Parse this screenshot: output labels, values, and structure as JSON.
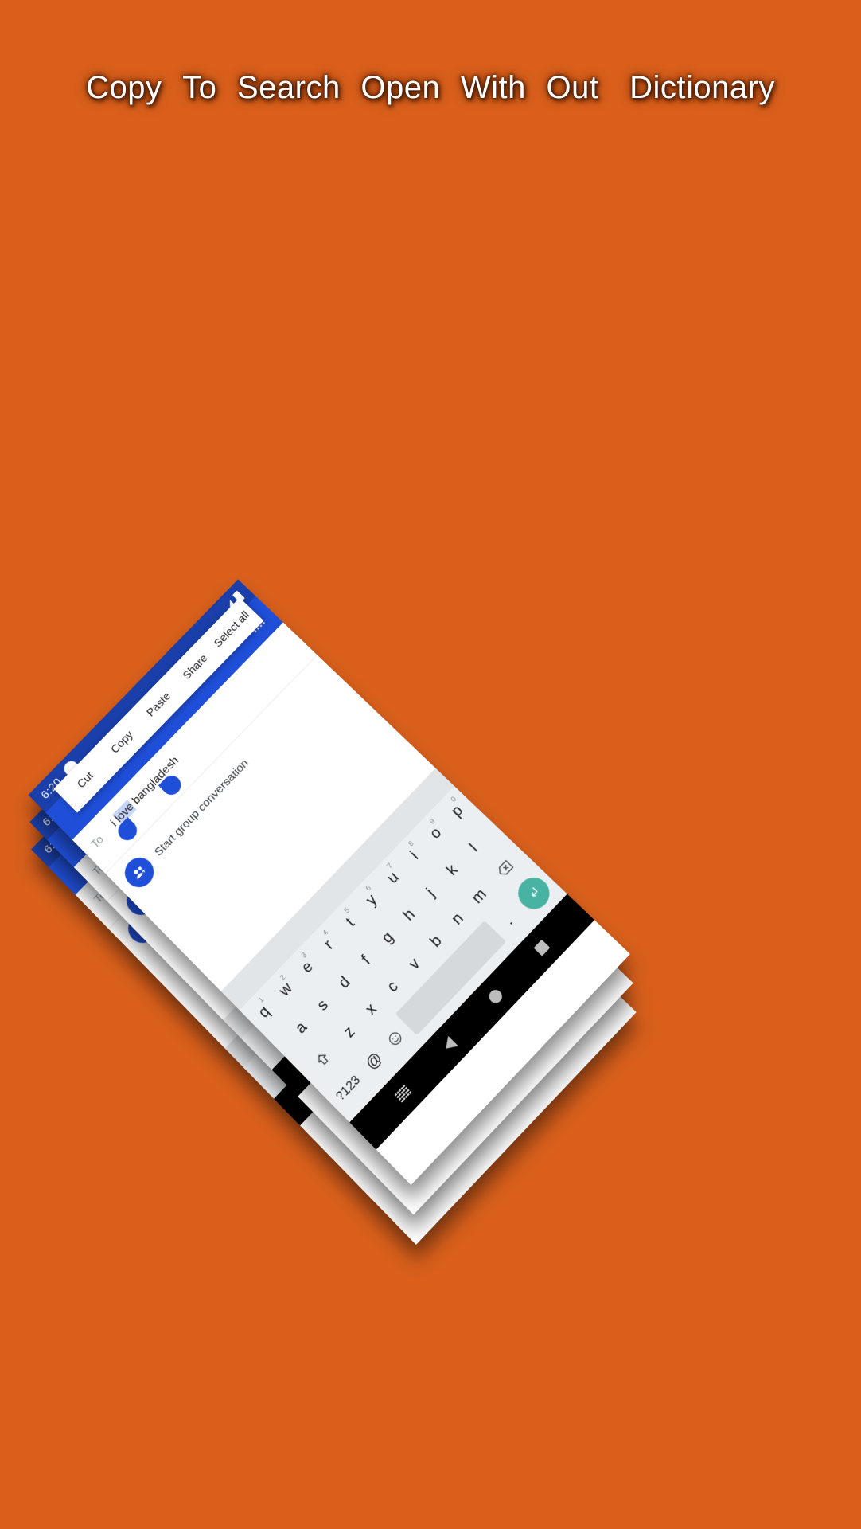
{
  "background_color": "#d95f1b",
  "header": {
    "words": [
      "Copy",
      "To",
      "Search",
      "Open",
      "With",
      "Out",
      "Dictionary"
    ],
    "text_color": "#ffffff",
    "shadow_color": "#3c1604"
  },
  "phone": {
    "status_bar": {
      "time": "6:20",
      "background_color": "#1a3faa",
      "icons": [
        "wifi-signal-icon",
        "battery-icon"
      ]
    },
    "app_bar": {
      "background_color": "#1f4fd8",
      "overflow_icon": "apps-grid-icon"
    },
    "context_menu": {
      "items": [
        "Cut",
        "Copy",
        "Paste",
        "Share",
        "Select all"
      ]
    },
    "compose": {
      "to_label": "To",
      "to_value": "i love bangladesh",
      "selected_fragment": "love",
      "group_label": "Start group conversation",
      "group_icon": "add-group-icon",
      "accent_color": "#1f4fd8",
      "selection_color": "#c6d4f7"
    },
    "keyboard": {
      "background_color": "#eceff1",
      "rows": [
        [
          {
            "label": "q",
            "num": "1"
          },
          {
            "label": "w",
            "num": "2"
          },
          {
            "label": "e",
            "num": "3"
          },
          {
            "label": "r",
            "num": "4"
          },
          {
            "label": "t",
            "num": "5"
          },
          {
            "label": "y",
            "num": "6"
          },
          {
            "label": "u",
            "num": "7"
          },
          {
            "label": "i",
            "num": "8"
          },
          {
            "label": "o",
            "num": "9"
          },
          {
            "label": "p",
            "num": "0"
          }
        ],
        [
          {
            "label": "a",
            "num": ""
          },
          {
            "label": "s",
            "num": ""
          },
          {
            "label": "d",
            "num": ""
          },
          {
            "label": "f",
            "num": ""
          },
          {
            "label": "g",
            "num": ""
          },
          {
            "label": "h",
            "num": ""
          },
          {
            "label": "j",
            "num": ""
          },
          {
            "label": "k",
            "num": ""
          },
          {
            "label": "l",
            "num": ""
          }
        ],
        [
          {
            "label": "shift-icon",
            "num": ""
          },
          {
            "label": "z",
            "num": ""
          },
          {
            "label": "x",
            "num": ""
          },
          {
            "label": "c",
            "num": ""
          },
          {
            "label": "v",
            "num": ""
          },
          {
            "label": "b",
            "num": ""
          },
          {
            "label": "n",
            "num": ""
          },
          {
            "label": "m",
            "num": ""
          },
          {
            "label": "backspace-icon",
            "num": ""
          }
        ]
      ],
      "bottom_row": {
        "symbols_key": "?123",
        "at_key": "@",
        "emoji_key": "emoji-icon",
        "space_key": "",
        "period_key": ".",
        "enter_key": "enter-icon",
        "enter_color": "#49b3a3"
      }
    },
    "nav_bar": {
      "background_color": "#000000",
      "items": [
        "hide-keyboard-icon",
        "back-triangle-icon",
        "home-square-icon",
        "recents-circle-icon"
      ]
    }
  }
}
